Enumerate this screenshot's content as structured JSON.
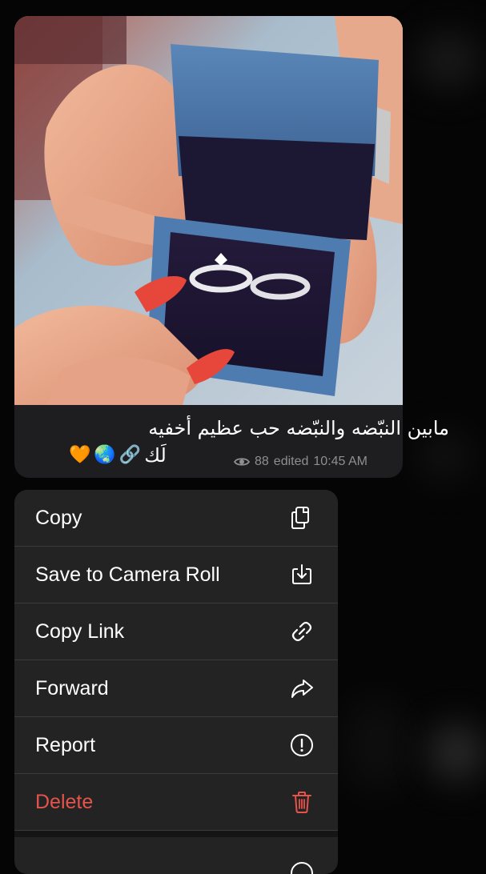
{
  "message": {
    "caption_line1": "مابين النبّضه والنبّضه حب عظيم أخفيه",
    "caption_line2": "لَك",
    "caption_emojis": [
      "🔗",
      "🌏",
      "🧡"
    ],
    "views": "88",
    "edited_label": "edited",
    "time": "10:45 AM",
    "icons": {
      "views": "eye-icon"
    }
  },
  "context_menu": {
    "items": [
      {
        "label": "Copy",
        "icon": "copy-icon",
        "destructive": false
      },
      {
        "label": "Save to Camera Roll",
        "icon": "download-icon",
        "destructive": false
      },
      {
        "label": "Copy Link",
        "icon": "link-icon",
        "destructive": false
      },
      {
        "label": "Forward",
        "icon": "forward-arrow-icon",
        "destructive": false
      },
      {
        "label": "Report",
        "icon": "exclamation-circle-icon",
        "destructive": false
      },
      {
        "label": "Delete",
        "icon": "trash-icon",
        "destructive": true
      }
    ]
  },
  "colors": {
    "background": "#050505",
    "bubble": "#1e1e20",
    "menu": "#232324",
    "destructive": "#e5534b",
    "meta_text": "#8e8e93"
  }
}
